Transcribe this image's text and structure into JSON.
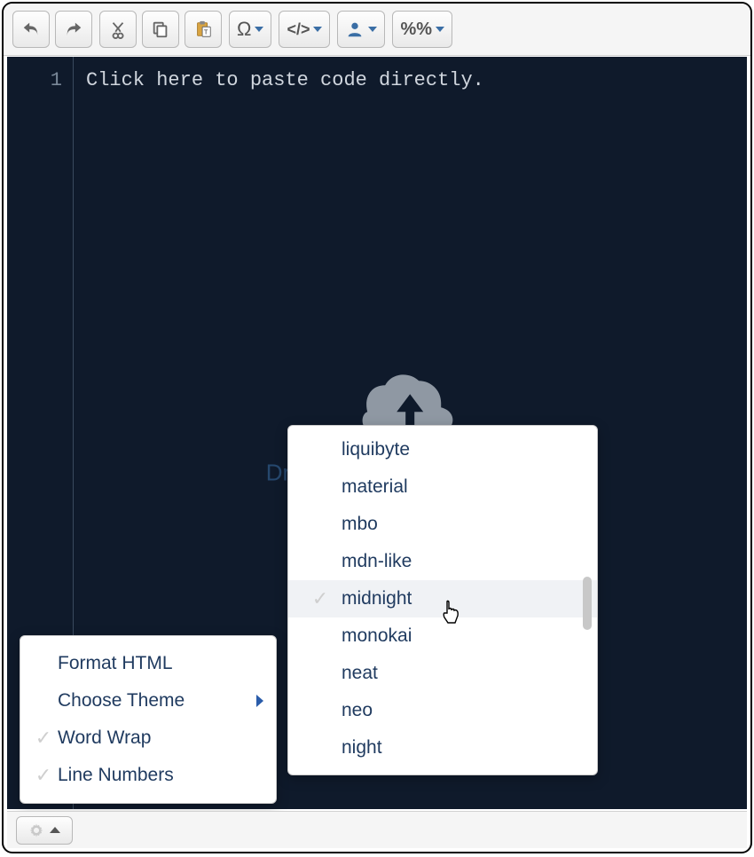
{
  "toolbar": {
    "omega_label": "Ω",
    "code_label": "</>",
    "percent_label": "%%"
  },
  "editor": {
    "line_number": "1",
    "placeholder": "Click here to paste code directly."
  },
  "drop_hint": "Drag text or HTML files here",
  "settings_menu": {
    "format_html": "Format HTML",
    "choose_theme": "Choose Theme",
    "word_wrap": "Word Wrap",
    "line_numbers": "Line Numbers"
  },
  "theme_menu": {
    "items": [
      {
        "label": "liquibyte",
        "selected": false
      },
      {
        "label": "material",
        "selected": false
      },
      {
        "label": "mbo",
        "selected": false
      },
      {
        "label": "mdn-like",
        "selected": false
      },
      {
        "label": "midnight",
        "selected": true
      },
      {
        "label": "monokai",
        "selected": false
      },
      {
        "label": "neat",
        "selected": false
      },
      {
        "label": "neo",
        "selected": false
      },
      {
        "label": "night",
        "selected": false
      }
    ]
  }
}
